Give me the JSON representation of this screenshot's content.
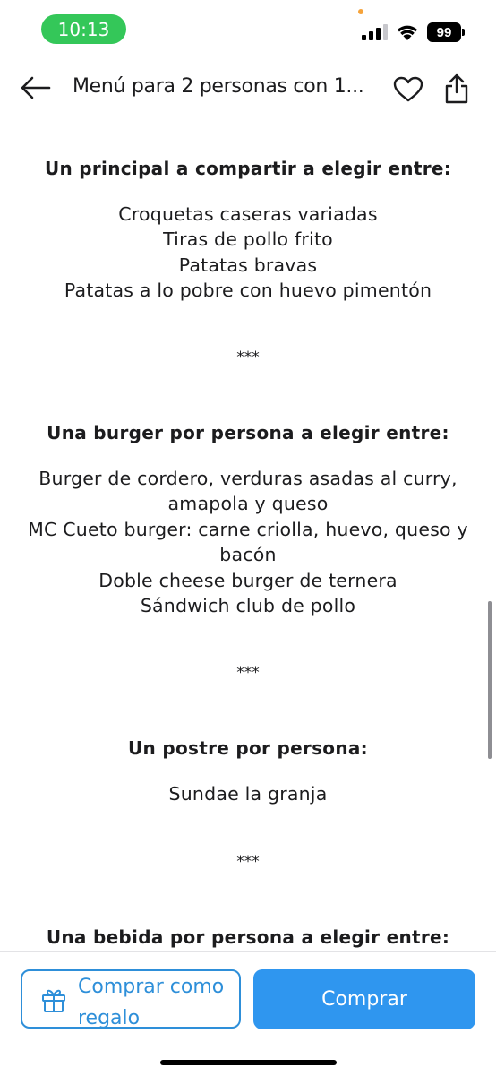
{
  "status_bar": {
    "time": "10:13",
    "battery": "99",
    "time_pill_color": "#34c759",
    "icons": [
      "signal-icon",
      "wifi-icon",
      "battery-icon"
    ]
  },
  "header": {
    "title": "Menú para 2 personas con 1...",
    "icons": [
      "back-arrow-icon",
      "heart-icon",
      "share-icon"
    ]
  },
  "sections": [
    {
      "heading": "Un principal a compartir a elegir entre:",
      "items": [
        "Croquetas caseras variadas",
        "Tiras de pollo frito",
        "Patatas bravas",
        "Patatas a lo pobre con huevo pimentón"
      ]
    },
    {
      "heading": "Una burger por persona a elegir entre:",
      "items": [
        "Burger de cordero, verduras asadas al curry, amapola y queso",
        "MC Cueto burger: carne criolla, huevo, queso y bacón",
        "Doble cheese burger de ternera",
        "Sándwich club de pollo"
      ]
    },
    {
      "heading": "Un postre por persona:",
      "items": [
        "Sundae la granja"
      ]
    },
    {
      "heading": "Una bebida por persona a elegir entre:",
      "items": []
    }
  ],
  "separators": [
    "***",
    "***",
    "***"
  ],
  "footer": {
    "gift_label": "Comprar como regalo",
    "buy_label": "Comprar",
    "gift_icon": "gift-icon",
    "accent_color": "#2e8fd9",
    "buy_color": "#2f96ef"
  }
}
